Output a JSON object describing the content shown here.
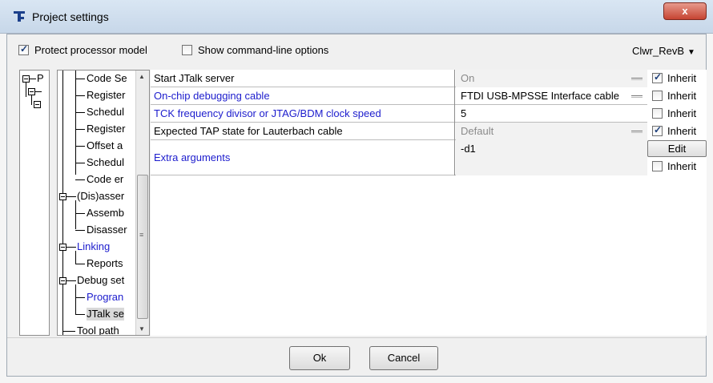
{
  "window": {
    "title": "Project settings",
    "close_label": "x"
  },
  "toolbar": {
    "protect_label": "Protect processor model",
    "protect_checked": true,
    "cmdline_label": "Show command-line options",
    "cmdline_checked": false,
    "model_selected": "Clwr_RevB"
  },
  "tree_left": {
    "items": [
      {
        "label": "P"
      }
    ]
  },
  "tree_mid": {
    "items": [
      {
        "label": "Code Se"
      },
      {
        "label": "Register"
      },
      {
        "label": "Schedul"
      },
      {
        "label": "Register"
      },
      {
        "label": "Offset a"
      },
      {
        "label": "Schedul"
      },
      {
        "label": "Code er"
      },
      {
        "label": "(Dis)asser"
      },
      {
        "label": "Assemb"
      },
      {
        "label": "Disasser"
      },
      {
        "label": "Linking"
      },
      {
        "label": "Reports"
      },
      {
        "label": "Debug set"
      },
      {
        "label": "Progran"
      },
      {
        "label": "JTalk se"
      },
      {
        "label": "Tool path"
      }
    ]
  },
  "properties": {
    "rows": [
      {
        "name": "Start JTalk server",
        "value": "On",
        "inherit_label": "Inherit"
      },
      {
        "name": "On-chip debugging cable",
        "value": "FTDI USB-MPSSE Interface cable",
        "inherit_label": "Inherit"
      },
      {
        "name": "TCK frequency divisor or JTAG/BDM clock speed",
        "value": "5",
        "inherit_label": "Inherit"
      },
      {
        "name": "Expected TAP state for Lauterbach cable",
        "value": "Default",
        "inherit_label": "Inherit"
      },
      {
        "name": "Extra arguments",
        "value": "-d1",
        "inherit_label": "Inherit"
      }
    ],
    "edit_label": "Edit"
  },
  "footer": {
    "ok_label": "Ok",
    "cancel_label": "Cancel"
  },
  "colors": {
    "link_blue": "#1c1ccd",
    "disabled_grey": "#8a8a8a"
  }
}
